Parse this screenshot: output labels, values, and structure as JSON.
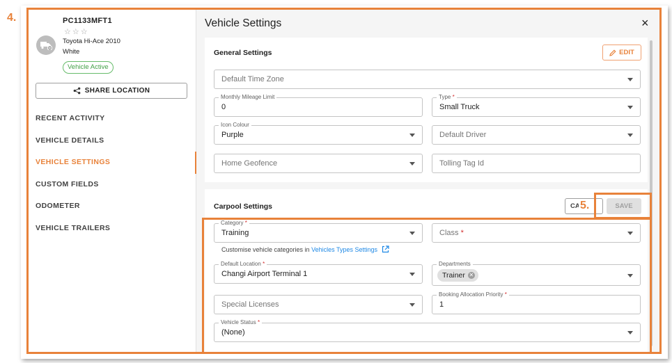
{
  "annotations": {
    "step4": "4.",
    "step5": "5."
  },
  "vehicle": {
    "id": "PC1133MFT1",
    "stars": "☆☆☆",
    "model": "Toyota Hi-Ace 2010",
    "colour": "White",
    "status": "Vehicle Active",
    "status_color": "#43a047"
  },
  "sidebar": {
    "share_label": "SHARE LOCATION",
    "items": [
      {
        "label": "RECENT ACTIVITY"
      },
      {
        "label": "VEHICLE DETAILS"
      },
      {
        "label": "VEHICLE SETTINGS",
        "active": true
      },
      {
        "label": "CUSTOM FIELDS"
      },
      {
        "label": "ODOMETER"
      },
      {
        "label": "VEHICLE TRAILERS"
      }
    ]
  },
  "dialog": {
    "title": "Vehicle Settings",
    "close_icon": "×"
  },
  "general": {
    "title": "General Settings",
    "edit_label": "EDIT",
    "default_time_zone": {
      "placeholder": "Default Time Zone"
    },
    "monthly_mileage": {
      "label": "Monthly Mileage Limit",
      "value": "0"
    },
    "type": {
      "label": "Type",
      "required": "*",
      "value": "Small Truck"
    },
    "icon_colour": {
      "label": "Icon Colour",
      "value": "Purple"
    },
    "default_driver": {
      "placeholder": "Default Driver"
    },
    "home_geofence": {
      "placeholder": "Home Geofence"
    },
    "tolling_tag": {
      "placeholder": "Tolling Tag Id"
    }
  },
  "carpool": {
    "title": "Carpool Settings",
    "cancel_label": "CA",
    "save_label": "SAVE",
    "category": {
      "label": "Category",
      "required": "*",
      "value": "Training"
    },
    "class": {
      "placeholder": "Class",
      "required": "*"
    },
    "hint_text": "Customise vehicle categories in",
    "hint_link": "Vehicles Types Settings",
    "default_location": {
      "label": "Default Location",
      "required": "*",
      "value": "Changi Airport Terminal 1"
    },
    "departments": {
      "label": "Departments",
      "chip": "Trainer"
    },
    "special_licenses": {
      "placeholder": "Special Licenses"
    },
    "booking_priority": {
      "label": "Booking Allocation Priority",
      "required": "*",
      "value": "1"
    },
    "vehicle_status": {
      "label": "Vehicle Status",
      "required": "*",
      "value": "(None)"
    }
  },
  "colors": {
    "accent": "#e8823a",
    "link": "#1e88e5",
    "required": "#d32f2f"
  }
}
